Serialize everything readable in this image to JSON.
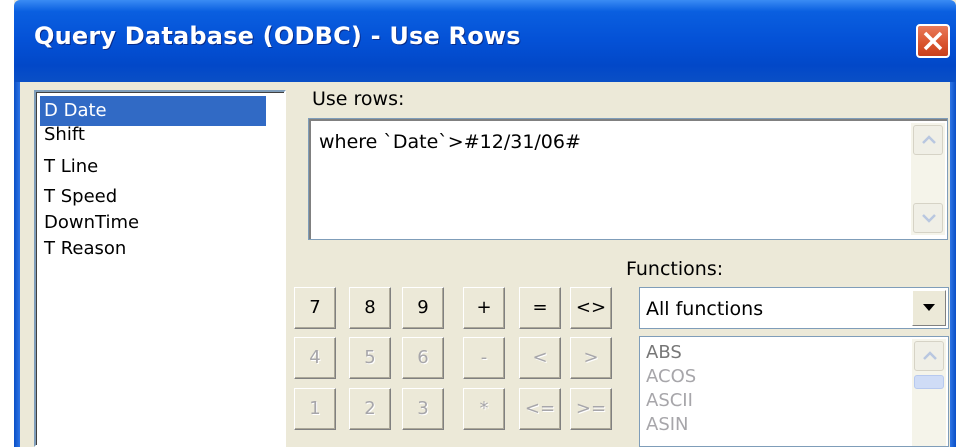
{
  "window": {
    "title": "Query Database (ODBC) - Use Rows"
  },
  "fields": [
    {
      "label": "D Date"
    },
    {
      "label": "Shift"
    },
    {
      "label": "T Line"
    },
    {
      "label": "T Speed"
    },
    {
      "label": "DownTime"
    },
    {
      "label": "T Reason"
    }
  ],
  "use_rows": {
    "label": "Use rows:",
    "value": "where  `Date`>#12/31/06#"
  },
  "keypad": {
    "row1": [
      "7",
      "8",
      "9",
      "+",
      "=",
      "<>"
    ],
    "row2": [
      "4",
      "5",
      "6",
      "-",
      "<",
      ">"
    ],
    "row3": [
      "1",
      "2",
      "3",
      "*",
      "<=",
      ">="
    ]
  },
  "functions": {
    "label": "Functions:",
    "selected": "All functions",
    "items": [
      "ABS",
      "ACOS",
      "ASCII",
      "ASIN"
    ]
  },
  "colors": {
    "titlebar": "#0451d6",
    "selection": "#316ac5",
    "dialog_bg": "#ece9d8"
  }
}
